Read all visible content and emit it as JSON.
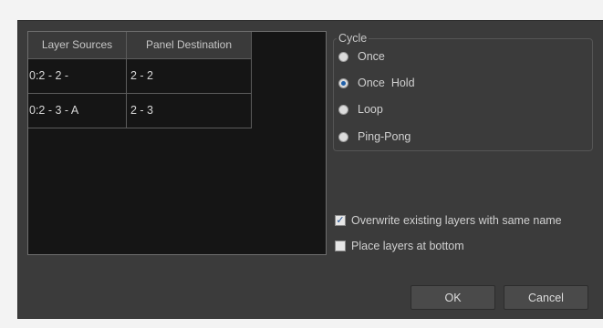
{
  "table": {
    "headers": [
      "Layer Sources",
      "Panel Destination"
    ],
    "rows": [
      [
        "0:2 - 2 -",
        "2 - 2"
      ],
      [
        "0:2 - 3 - A",
        "2 - 3"
      ]
    ]
  },
  "cycle": {
    "title": "Cycle",
    "options": [
      "Once",
      "Once  Hold",
      "Loop",
      "Ping-Pong"
    ],
    "selected": "Once  Hold"
  },
  "options": {
    "overwrite_label": "Overwrite existing layers with same name",
    "overwrite_checked": true,
    "bottom_label": "Place layers at bottom",
    "bottom_checked": false
  },
  "buttons": {
    "ok_label": "OK",
    "cancel_label": "Cancel"
  },
  "colors": {
    "dialog_bg": "#3b3b3b",
    "table_bg": "#151515",
    "radio_selected": "#1f5fa8"
  }
}
